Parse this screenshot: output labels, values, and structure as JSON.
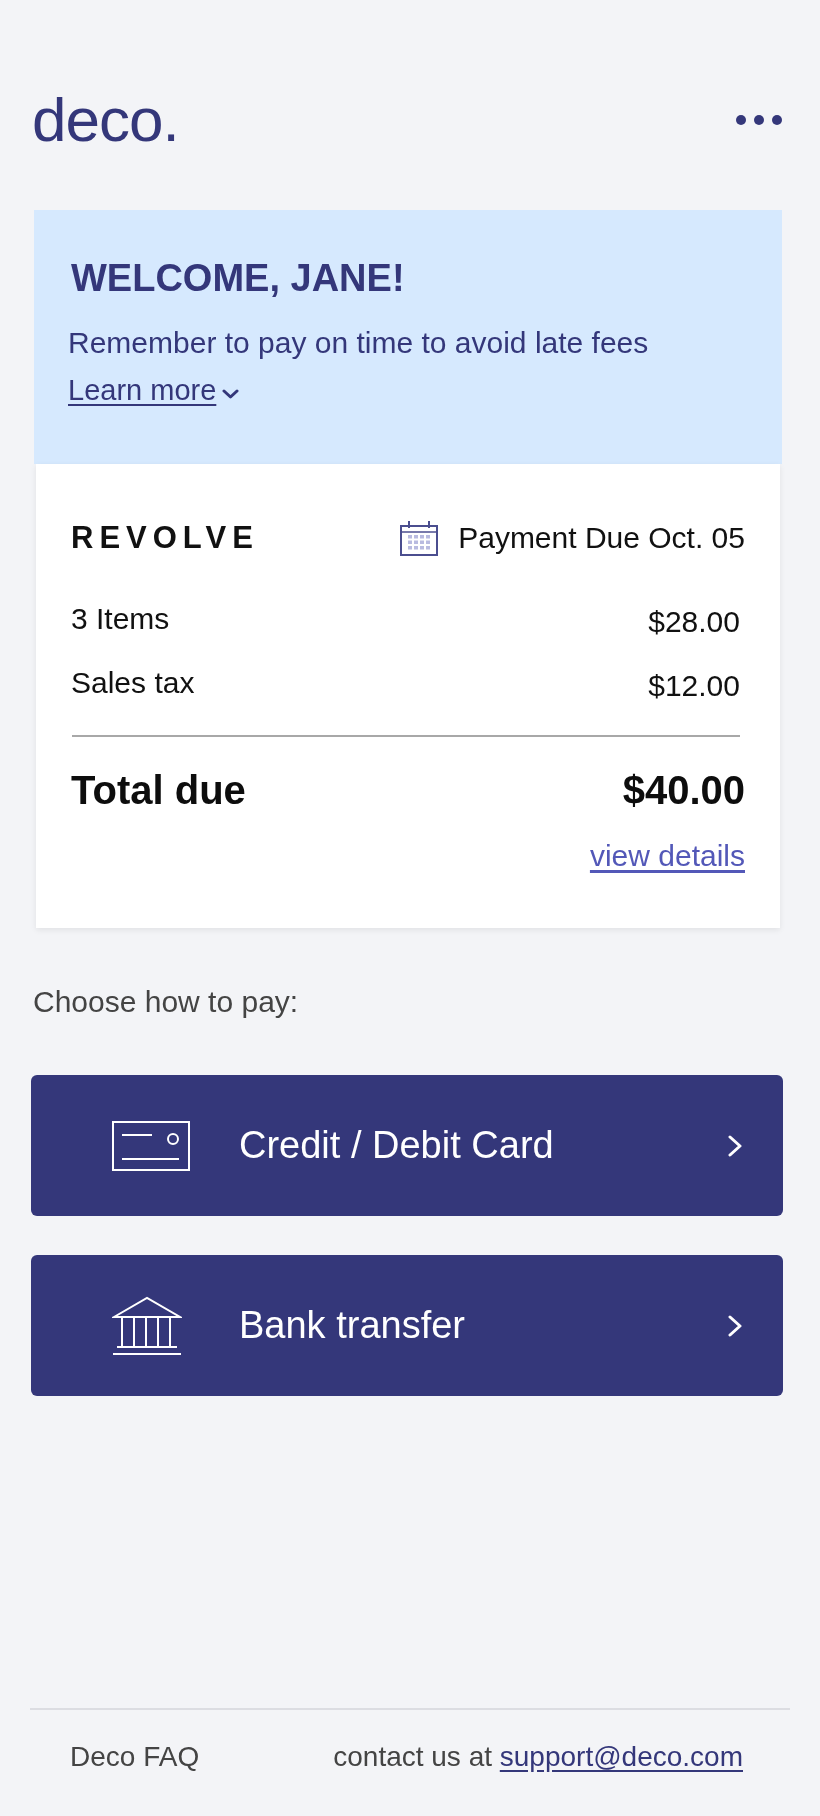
{
  "header": {
    "logo": "deco."
  },
  "banner": {
    "title": "WELCOME, JANE!",
    "message": "Remember to pay on time to avoid late fees",
    "link": {
      "label": "Learn more",
      "expanded": false
    }
  },
  "bill": {
    "merchant": "REVOLVE",
    "due": "Payment Due Oct. 05",
    "lines": [
      {
        "label": "3 Items",
        "amount": "$28.00"
      },
      {
        "label": "Sales tax",
        "amount": "$12.00"
      }
    ],
    "total": {
      "label": "Total due",
      "amount": "$40.00"
    },
    "details_link": "view details"
  },
  "payment": {
    "prompt": "Choose how to pay:",
    "options": [
      {
        "kind": "card",
        "label": "Credit / Debit Card"
      },
      {
        "kind": "bank",
        "label": "Bank transfer"
      }
    ]
  },
  "footer": {
    "faq_link": "Deco FAQ",
    "contact_text": "contact us at",
    "contact_email": "support@deco.com"
  }
}
